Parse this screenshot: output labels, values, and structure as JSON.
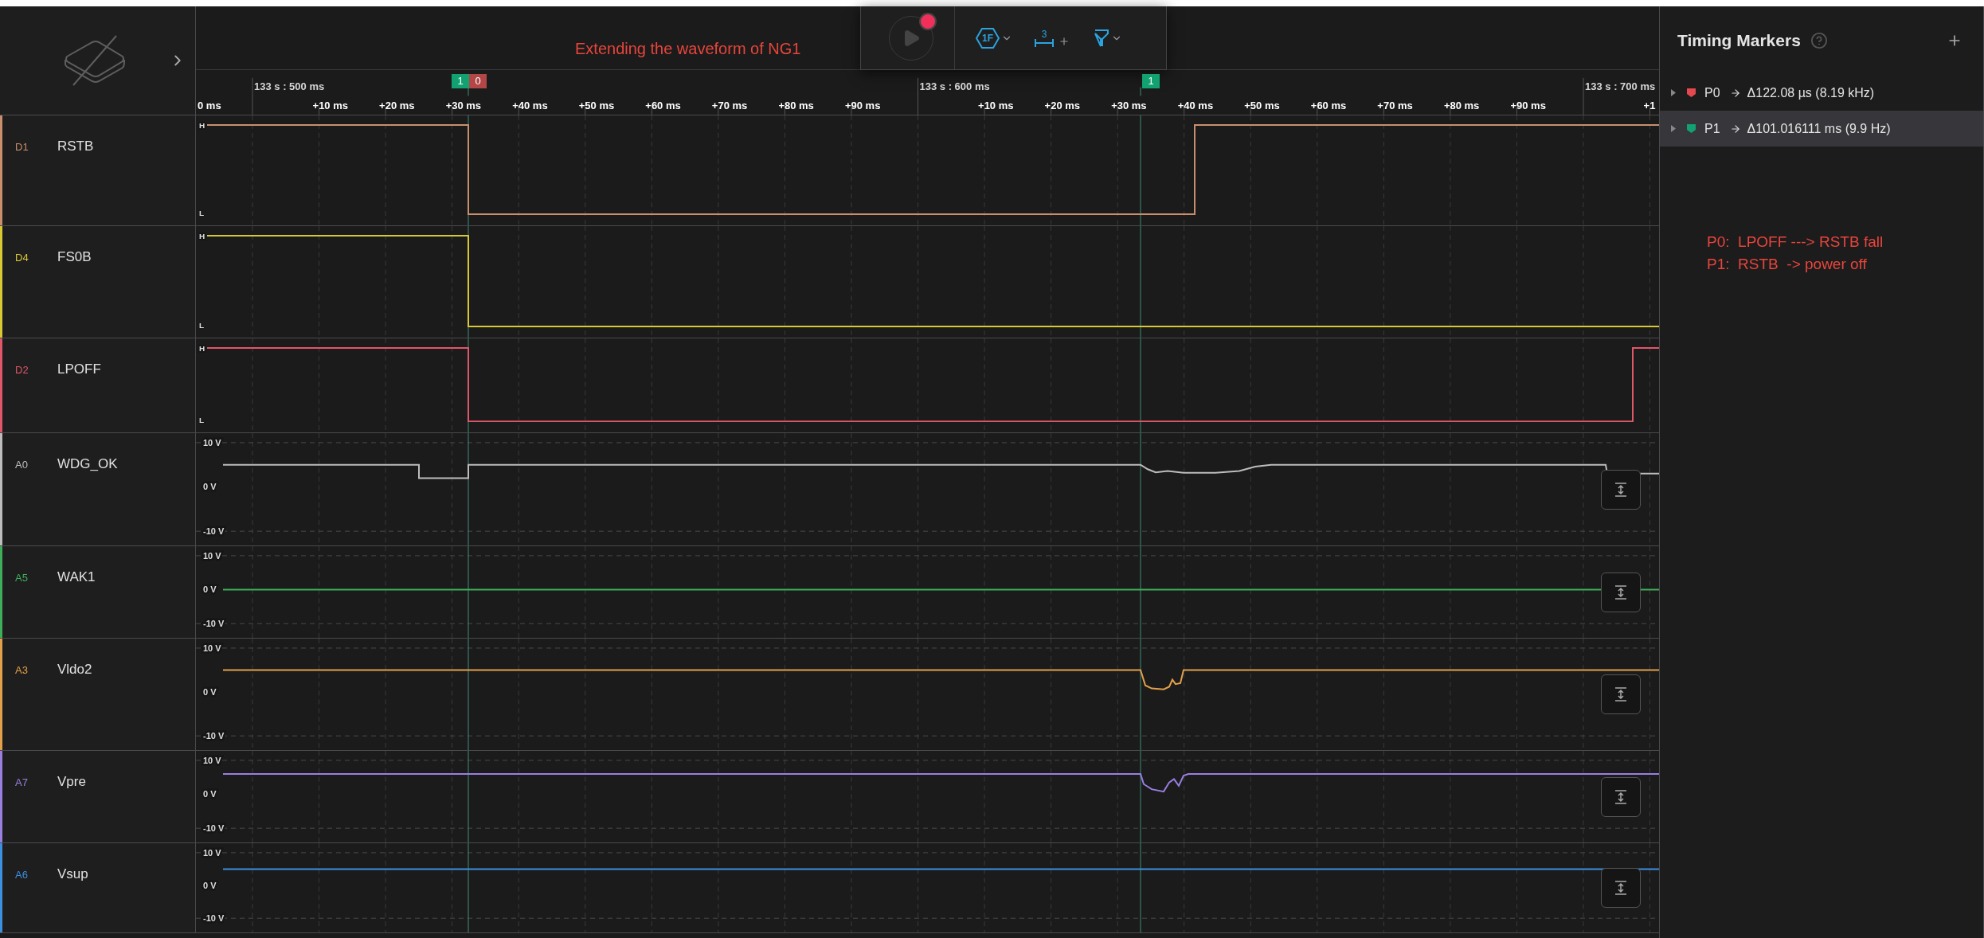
{
  "annotation": "Extending the waveform of NG1",
  "toolbar": [
    {
      "kind": "play"
    },
    {
      "kind": "trigger",
      "label": "1F"
    },
    {
      "kind": "measure",
      "label": "3"
    },
    {
      "kind": "filter"
    }
  ],
  "ruler": {
    "leading_label": "0 ms",
    "segments": [
      {
        "major": "133 s : 500 ms",
        "minors": [
          "+10 ms",
          "+20 ms",
          "+30 ms",
          "+40 ms",
          "+50 ms",
          "+60 ms",
          "+70 ms",
          "+80 ms",
          "+90 ms"
        ]
      },
      {
        "major": "133 s : 600 ms",
        "minors": [
          "+10 ms",
          "+20 ms",
          "+30 ms",
          "+40 ms",
          "+50 ms",
          "+60 ms",
          "+70 ms",
          "+80 ms",
          "+90 ms"
        ]
      },
      {
        "major": "133 s : 700 ms",
        "minors": [
          "+1"
        ]
      }
    ]
  },
  "ruler_markers": [
    {
      "label": "1",
      "color": "#12a272"
    },
    {
      "label": "0",
      "color": "#b34747"
    },
    {
      "label": "1",
      "color": "#12a272"
    }
  ],
  "channels": [
    {
      "id": "D1",
      "name": "RSTB",
      "kind": "digital",
      "color": "#c98f6d",
      "high": "H",
      "low": "L"
    },
    {
      "id": "D4",
      "name": "FS0B",
      "kind": "digital",
      "color": "#d8c934",
      "high": "H",
      "low": "L"
    },
    {
      "id": "D2",
      "name": "LPOFF",
      "kind": "digital",
      "color": "#e0566a",
      "high": "H",
      "low": "L"
    },
    {
      "id": "A0",
      "name": "WDG_OK",
      "kind": "analog",
      "color": "#bdbdbd",
      "scale": [
        "10 V",
        "0 V",
        "-10 V"
      ]
    },
    {
      "id": "A5",
      "name": "WAK1",
      "kind": "analog",
      "color": "#3fae5a",
      "scale": [
        "10 V",
        "0 V",
        "-10 V"
      ]
    },
    {
      "id": "A3",
      "name": "Vldo2",
      "kind": "analog",
      "color": "#e3a04a",
      "scale": [
        "10 V",
        "0 V",
        "-10 V"
      ]
    },
    {
      "id": "A7",
      "name": "Vpre",
      "kind": "analog",
      "color": "#9a7fe0",
      "scale": [
        "10 V",
        "0 V",
        "-10 V"
      ]
    },
    {
      "id": "A6",
      "name": "Vsup",
      "kind": "analog",
      "color": "#3d8fe0",
      "scale": [
        "10 V",
        "0 V",
        "-10 V"
      ]
    }
  ],
  "timing_markers": {
    "title": "Timing Markers",
    "items": [
      {
        "name": "P0",
        "value": "Δ122.08 µs (8.19 kHz)",
        "color": "#e5484d",
        "selected": false
      },
      {
        "name": "P1",
        "value": "Δ101.016111 ms (9.9 Hz)",
        "color": "#12a272",
        "selected": true
      }
    ]
  },
  "notes": [
    "P0:  LPOFF ---> RSTB fall",
    "P1:  RSTB  -> power off"
  ]
}
